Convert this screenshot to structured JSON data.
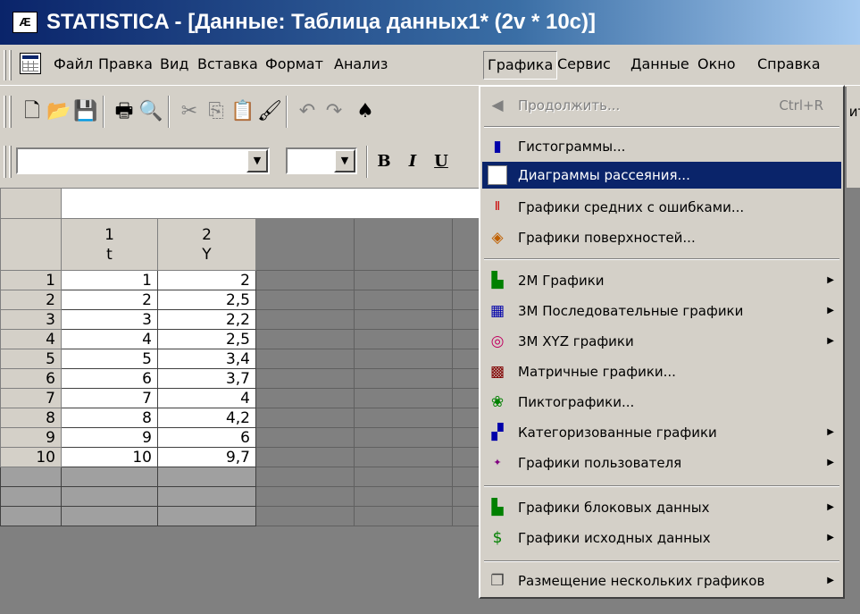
{
  "window": {
    "title": "STATISTICA - [Данные: Таблица данных1* (2v * 10c)]",
    "icon": "statistica-app-icon"
  },
  "menubar": {
    "items": [
      {
        "label": "Файл"
      },
      {
        "label": "Правка"
      },
      {
        "label": "Вид"
      },
      {
        "label": "Вставка"
      },
      {
        "label": "Формат"
      },
      {
        "label": "Анализ"
      },
      {
        "label": "Графика"
      },
      {
        "label": "Сервис"
      },
      {
        "label": "Данные"
      },
      {
        "label": "Окно"
      },
      {
        "label": "Справка"
      }
    ],
    "open_menu": "Графика"
  },
  "toolbar": {
    "icons": [
      "new-file-icon",
      "open-folder-icon",
      "save-icon",
      "print-icon",
      "print-preview-icon",
      "cut-icon",
      "copy-icon",
      "paste-icon",
      "format-painter-icon",
      "undo-icon",
      "redo-icon"
    ]
  },
  "format_toolbar": {
    "bold": "B",
    "italic": "I",
    "underline": "U"
  },
  "grid": {
    "columns": [
      {
        "number": "1",
        "name": "t"
      },
      {
        "number": "2",
        "name": "Y"
      }
    ],
    "rows": [
      {
        "n": "1",
        "t": "1",
        "y": "2"
      },
      {
        "n": "2",
        "t": "2",
        "y": "2,5"
      },
      {
        "n": "3",
        "t": "3",
        "y": "2,2"
      },
      {
        "n": "4",
        "t": "4",
        "y": "2,5"
      },
      {
        "n": "5",
        "t": "5",
        "y": "3,4"
      },
      {
        "n": "6",
        "t": "6",
        "y": "3,7"
      },
      {
        "n": "7",
        "t": "7",
        "y": "4"
      },
      {
        "n": "8",
        "t": "8",
        "y": "4,2"
      },
      {
        "n": "9",
        "t": "9",
        "y": "6"
      },
      {
        "n": "10",
        "t": "10",
        "y": "9,7"
      }
    ]
  },
  "dropdown": {
    "continue": {
      "label": "Продолжить...",
      "shortcut": "Ctrl+R"
    },
    "histograms": "Гистограммы...",
    "scatterplots": "Диаграммы рассеяния...",
    "means_errors": "Графики средних с ошибками...",
    "surfaces": "Графики поверхностей...",
    "g2d": "2М Графики",
    "g3d_seq": "3М Последовательные графики",
    "g3d_xyz": "3М XYZ графики",
    "matrix": "Матричные графики...",
    "icons": "Пиктографики...",
    "categorized": "Категоризованные графики",
    "user": "Графики пользователя",
    "block": "Графики блоковых данных",
    "source": "Графики исходных данных",
    "multiple": "Размещение нескольких графиков",
    "highlighted": "Диаграммы рассеяния..."
  }
}
